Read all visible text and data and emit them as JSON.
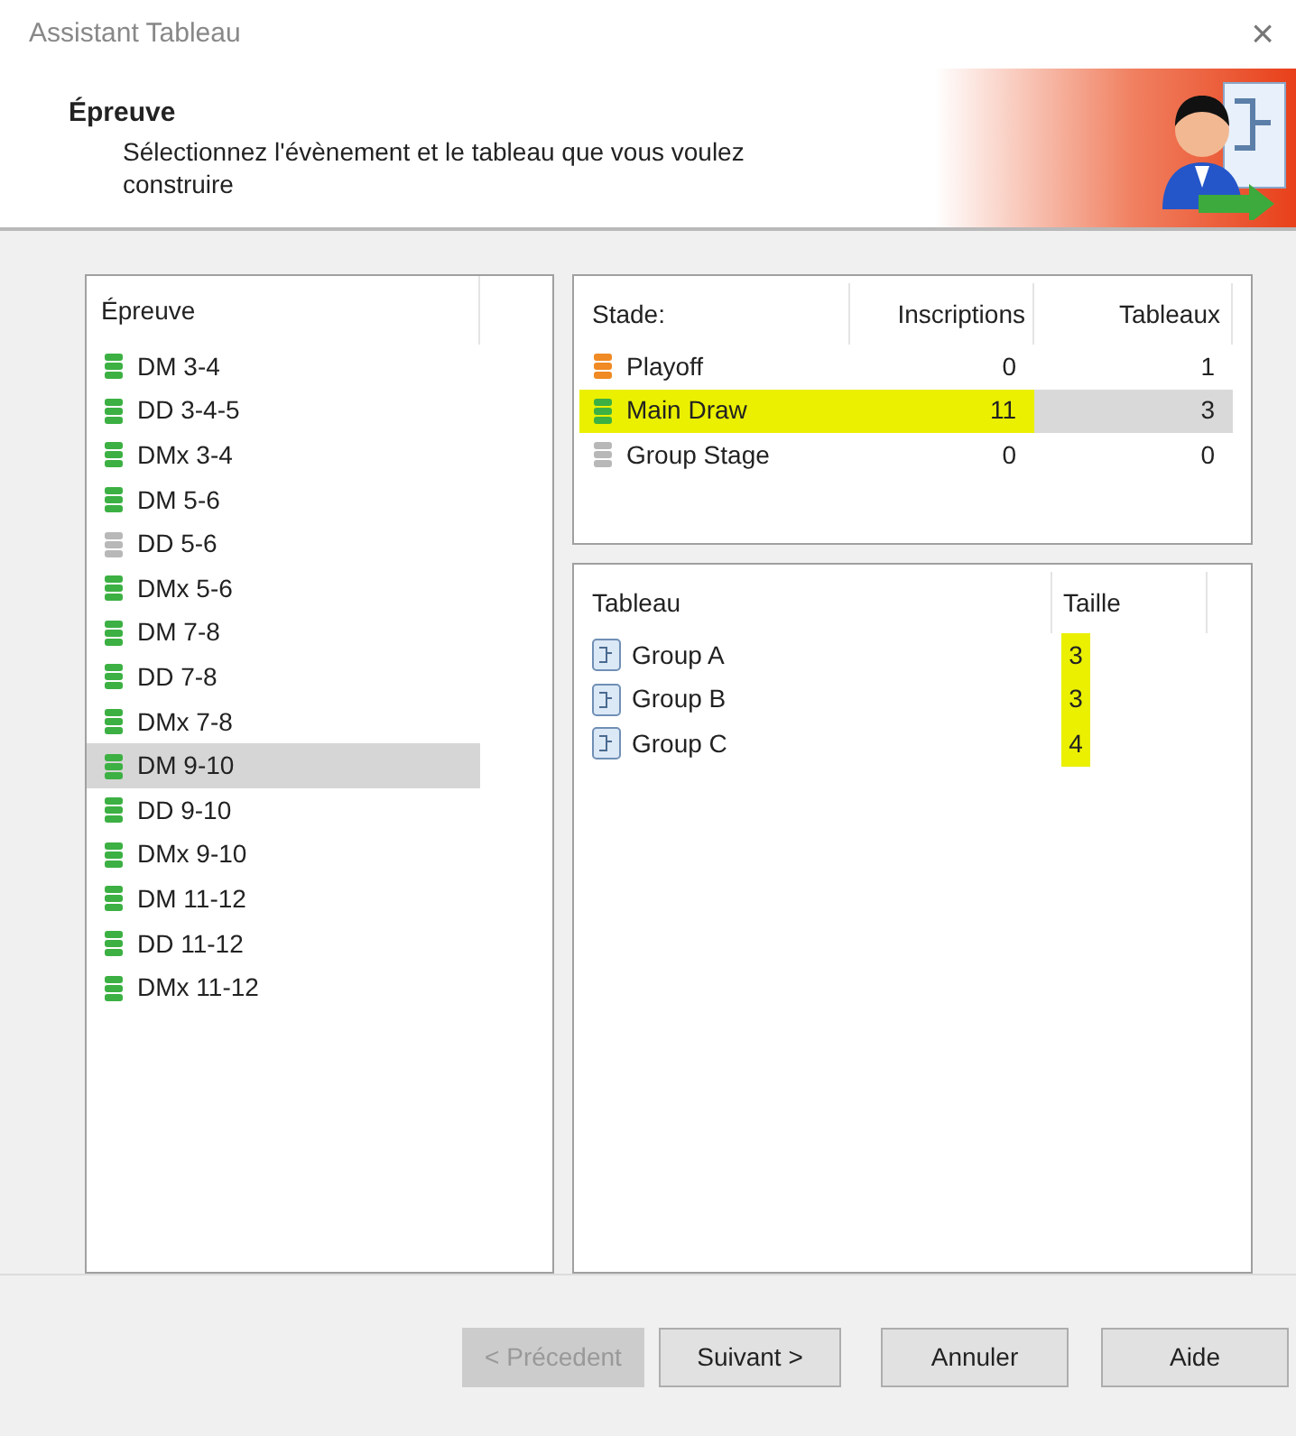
{
  "window": {
    "title": "Assistant Tableau",
    "close": "×"
  },
  "header": {
    "title": "Épreuve",
    "subtitle": "Sélectionnez l'évènement et le tableau que vous voulez construire"
  },
  "events": {
    "columns": [
      "Épreuve"
    ],
    "items": [
      {
        "label": "DM 3-4",
        "color": "#3cb043",
        "selected": false
      },
      {
        "label": "DD 3-4-5",
        "color": "#3cb043",
        "selected": false
      },
      {
        "label": "DMx 3-4",
        "color": "#3cb043",
        "selected": false
      },
      {
        "label": "DM 5-6",
        "color": "#3cb043",
        "selected": false
      },
      {
        "label": "DD 5-6",
        "color": "#b8b8b8",
        "selected": false
      },
      {
        "label": "DMx 5-6",
        "color": "#3cb043",
        "selected": false
      },
      {
        "label": "DM 7-8",
        "color": "#3cb043",
        "selected": false
      },
      {
        "label": "DD 7-8",
        "color": "#3cb043",
        "selected": false
      },
      {
        "label": "DMx 7-8",
        "color": "#3cb043",
        "selected": false
      },
      {
        "label": "DM 9-10",
        "color": "#3cb043",
        "selected": true
      },
      {
        "label": "DD 9-10",
        "color": "#3cb043",
        "selected": false
      },
      {
        "label": "DMx 9-10",
        "color": "#3cb043",
        "selected": false
      },
      {
        "label": "DM 11-12",
        "color": "#3cb043",
        "selected": false
      },
      {
        "label": "DD 11-12",
        "color": "#3cb043",
        "selected": false
      },
      {
        "label": "DMx 11-12",
        "color": "#3cb043",
        "selected": false
      }
    ]
  },
  "stages": {
    "columns": [
      "Stade:",
      "Inscriptions",
      "Tableaux"
    ],
    "rows": [
      {
        "name": "Playoff",
        "inscriptions": "0",
        "tableaux": "1",
        "color": "#f08a24",
        "selected": false,
        "highlighted": false
      },
      {
        "name": "Main Draw",
        "inscriptions": "11",
        "tableaux": "3",
        "color": "#3cb043",
        "selected": true,
        "highlighted": true
      },
      {
        "name": "Group Stage",
        "inscriptions": "0",
        "tableaux": "0",
        "color": "#b8b8b8",
        "selected": false,
        "highlighted": false
      }
    ]
  },
  "draws": {
    "columns": [
      "Tableau",
      "Taille"
    ],
    "rows": [
      {
        "name": "Group A",
        "taille": "3",
        "highlighted": true
      },
      {
        "name": "Group B",
        "taille": "3",
        "highlighted": true
      },
      {
        "name": "Group C",
        "taille": "4",
        "highlighted": true
      }
    ]
  },
  "buttons": [
    {
      "label": "< Précedent",
      "disabled": true
    },
    {
      "label": "Suivant >",
      "disabled": false
    },
    {
      "label": "Annuler",
      "disabled": false
    },
    {
      "label": "Aide",
      "disabled": false
    }
  ]
}
